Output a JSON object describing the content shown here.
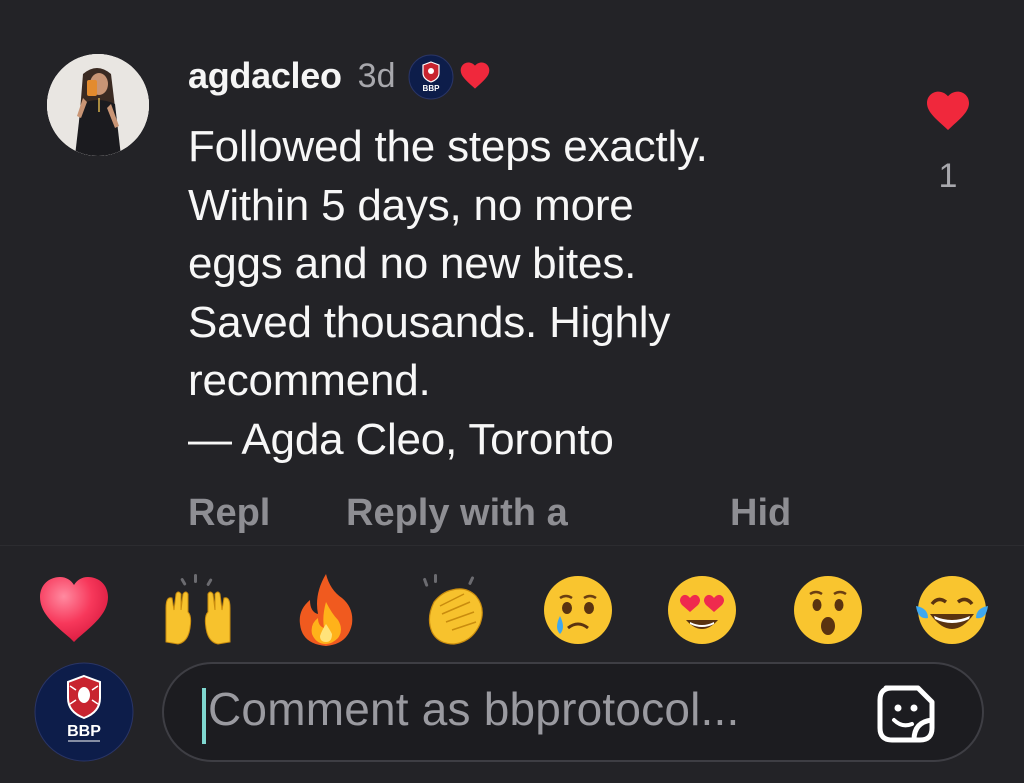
{
  "comment": {
    "username": "agdacleo",
    "timestamp": "3d",
    "author_badge": "BBP",
    "author_liked_icon": "heart-icon",
    "body_lines": [
      "Followed the steps exactly.",
      "Within 5 days, no more",
      "eggs and no new bites.",
      "Saved thousands. Highly",
      "recommend.",
      "— Agda Cleo, Toronto"
    ],
    "actions": {
      "reply": "Repl",
      "reply_with": "Reply with a",
      "hide": "Hid"
    },
    "like_count": "1"
  },
  "emoji_bar": [
    {
      "name": "red-heart-emoji"
    },
    {
      "name": "raising-hands-emoji"
    },
    {
      "name": "fire-emoji"
    },
    {
      "name": "clapping-hands-emoji"
    },
    {
      "name": "crying-face-emoji"
    },
    {
      "name": "heart-eyes-emoji"
    },
    {
      "name": "surprised-face-emoji"
    },
    {
      "name": "laughing-tears-emoji"
    }
  ],
  "composer": {
    "placeholder": "Comment as bbprotocol...",
    "avatar_badge": "BBP",
    "sticker_icon": "sticker-icon"
  },
  "colors": {
    "background": "#232327",
    "like_red": "#f0283c",
    "muted_text": "#8e8e93",
    "cursor": "#7fd7d0",
    "badge_navy": "#0d1d4a"
  }
}
